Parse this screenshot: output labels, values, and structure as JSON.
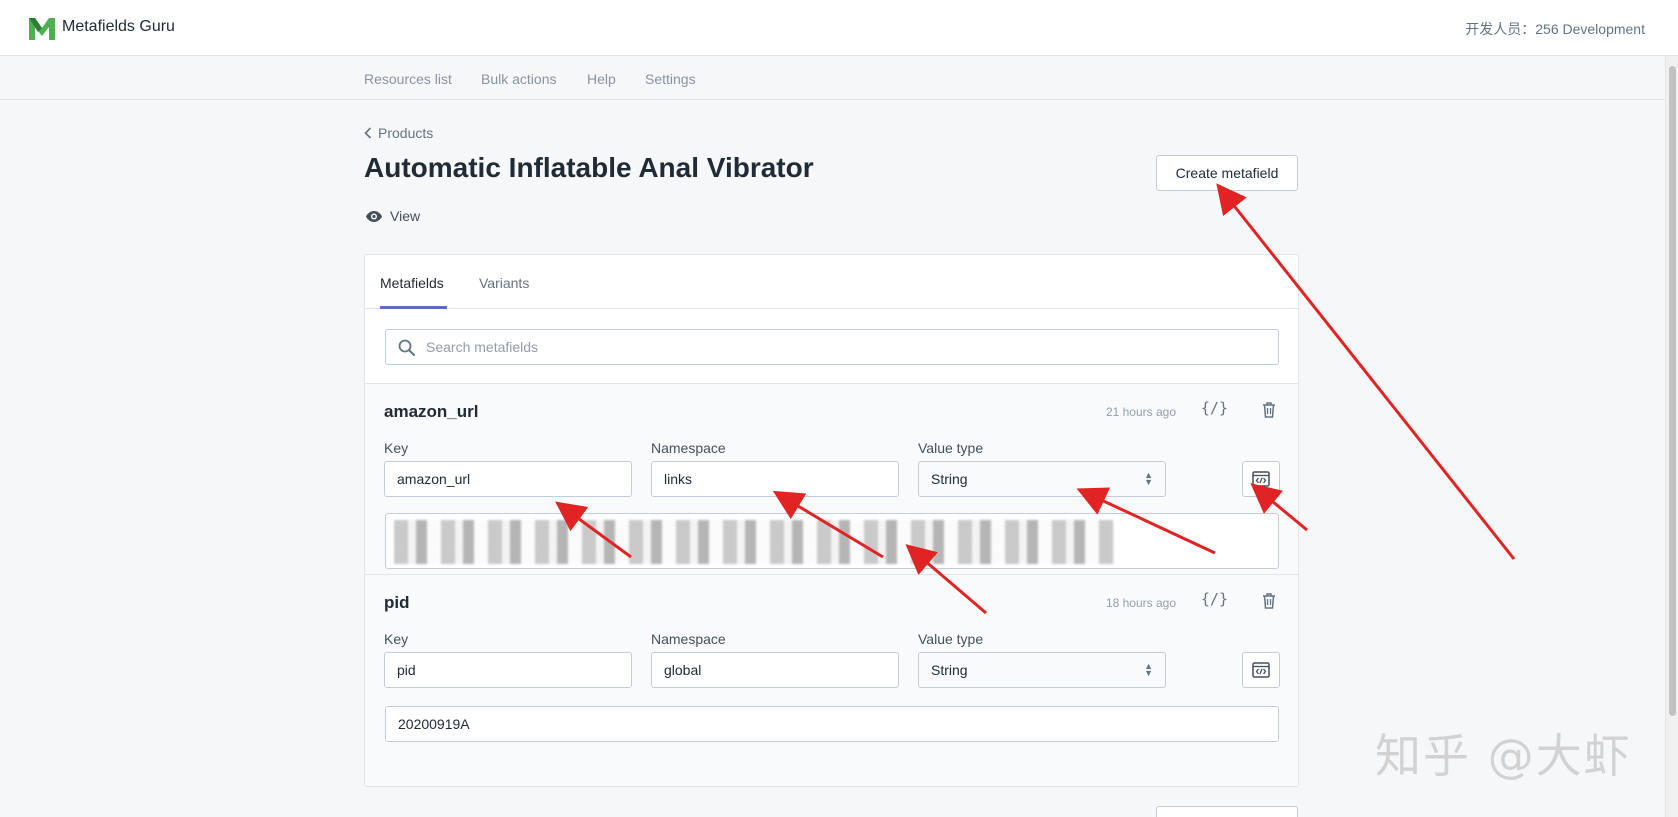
{
  "app": {
    "name": "Metafields Guru",
    "dev_info": "开发人员：256 Development"
  },
  "nav": {
    "items": [
      "Resources list",
      "Bulk actions",
      "Help",
      "Settings"
    ]
  },
  "breadcrumb": {
    "label": "Products"
  },
  "page": {
    "title": "Automatic Inflatable Anal Vibrator",
    "view_label": "View",
    "create_button": "Create metafield"
  },
  "tabs": [
    {
      "label": "Metafields",
      "active": true
    },
    {
      "label": "Variants",
      "active": false
    }
  ],
  "search": {
    "placeholder": "Search metafields"
  },
  "labels": {
    "key": "Key",
    "namespace": "Namespace",
    "value_type": "Value type",
    "code_icon": "{/}"
  },
  "metafields": [
    {
      "name": "amazon_url",
      "updated": "21 hours ago",
      "key": "amazon_url",
      "namespace": "links",
      "value_type": "String",
      "value": ""
    },
    {
      "name": "pid",
      "updated": "18 hours ago",
      "key": "pid",
      "namespace": "global",
      "value_type": "String",
      "value": "20200919A"
    }
  ],
  "watermark": "知乎 @大虾",
  "colors": {
    "tab_accent": "#5c6ac4",
    "logo_green": "#4caf50",
    "annotation_arrow": "#e02424"
  }
}
